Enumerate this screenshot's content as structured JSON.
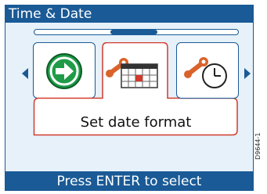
{
  "title": "Time & Date",
  "menu": {
    "items": [
      {
        "icon": "go-arrow-icon"
      },
      {
        "icon": "wrench-calendar-icon",
        "label": "Set date format",
        "selected": true
      },
      {
        "icon": "wrench-clock-icon"
      }
    ]
  },
  "footer": "Press ENTER to select",
  "side_code": "D9644-1",
  "colors": {
    "frame": "#1a5a96",
    "background": "#e6f1fa",
    "selection": "#d23a2a",
    "icon_green": "#1f9b47",
    "icon_orange": "#d9632a"
  }
}
